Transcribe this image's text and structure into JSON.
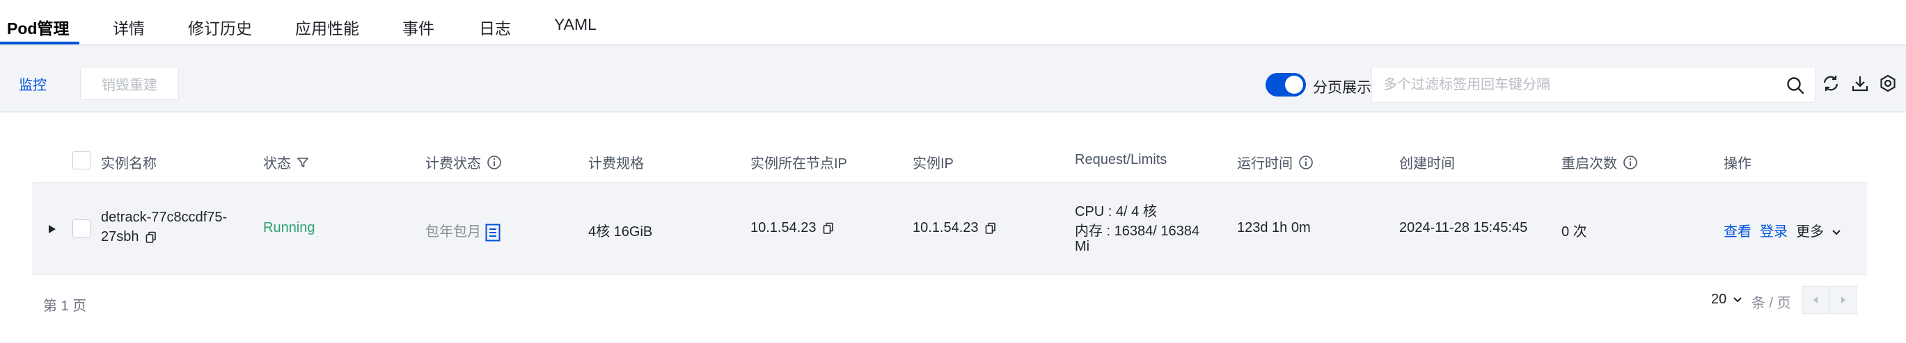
{
  "tabs": [
    {
      "label": "Pod管理",
      "active": true
    },
    {
      "label": "详情"
    },
    {
      "label": "修订历史"
    },
    {
      "label": "应用性能"
    },
    {
      "label": "事件"
    },
    {
      "label": "日志"
    },
    {
      "label": "YAML"
    }
  ],
  "toolbar": {
    "monitor_label": "监控",
    "rebuild_label": "销毁重建",
    "paging_toggle_label": "分页展示",
    "paging_toggle_on": true,
    "search_placeholder": "多个过滤标签用回车键分隔"
  },
  "table": {
    "headers": {
      "name": "实例名称",
      "status": "状态",
      "billing_status": "计费状态",
      "billing_spec": "计费规格",
      "node_ip": "实例所在节点IP",
      "instance_ip": "实例IP",
      "request_limits": "Request/Limits",
      "run_time": "运行时间",
      "created": "创建时间",
      "restarts": "重启次数",
      "actions": "操作"
    },
    "rows": [
      {
        "name_line1": "detrack-77c8ccdf75-",
        "name_line2": "27sbh",
        "status": "Running",
        "billing_status": "包年包月",
        "billing_spec": "4核 16GiB",
        "node_ip": "10.1.54.23",
        "instance_ip": "10.1.54.23",
        "cpu": "CPU : 4/ 4 核",
        "mem_line1": "内存 : 16384/ 16384",
        "mem_line2": "Mi",
        "run_time": "123d 1h 0m",
        "created": "2024-11-28 15:45:45",
        "restarts": "0 次",
        "action_view": "查看",
        "action_login": "登录",
        "action_more": "更多"
      }
    ]
  },
  "footer": {
    "page_label": "第 1 页",
    "page_size": "20",
    "page_size_unit": "条 / 页"
  },
  "colors": {
    "accent": "#0052d9",
    "running": "#2ba471"
  }
}
